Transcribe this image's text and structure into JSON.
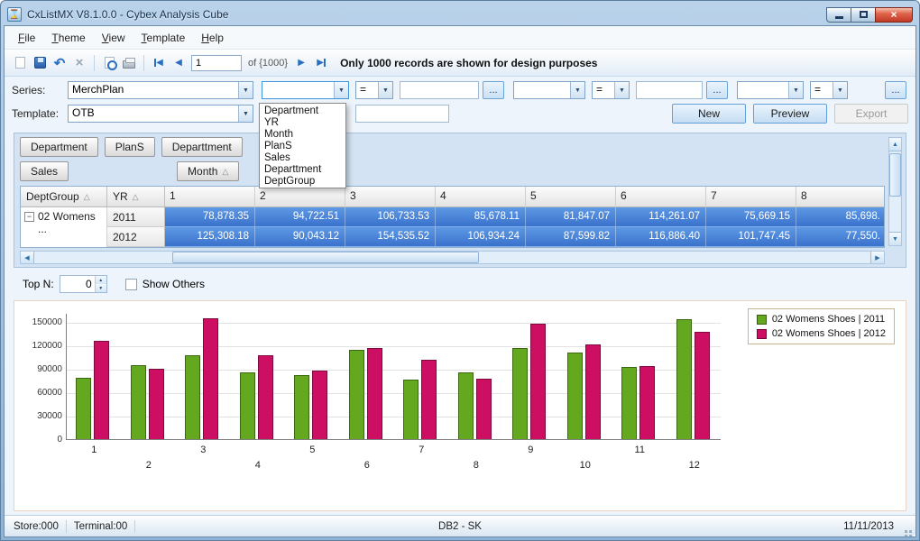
{
  "window": {
    "title": "CxListMX  V8.1.0.0 - Cybex Analysis Cube"
  },
  "icons": {
    "app": "⌛",
    "close": "×",
    "undo": "↶",
    "delete": "×",
    "combo_arrow": "▼",
    "sort_asc": "△",
    "collapse": "−",
    "nav_prev": "◀",
    "nav_next": "▶",
    "scroll_up": "▲",
    "scroll_down": "▼",
    "scroll_left": "◀",
    "scroll_right": "▶",
    "spin_up": "▲",
    "spin_down": "▼"
  },
  "menu": {
    "items": [
      "File",
      "Theme",
      "View",
      "Template",
      "Help"
    ]
  },
  "toolbar": {
    "page_value": "1",
    "of_label": "of {1000}",
    "message": "Only 1000 records are shown for design purposes"
  },
  "series": {
    "label": "Series:",
    "field_combo": "MerchPlan",
    "eq": "=",
    "ellipsis": "...",
    "dropdown_items": [
      "Department",
      "YR",
      "Month",
      "PlanS",
      "Sales",
      "Departtment",
      "DeptGroup"
    ]
  },
  "template": {
    "label": "Template:",
    "combo": "OTB",
    "new_label": "New",
    "preview_label": "Preview",
    "export_label": "Export"
  },
  "pivot": {
    "fields_row1": [
      "Department",
      "PlanS",
      "Departtment"
    ],
    "data_field": "Sales",
    "column_field": "Month",
    "row_field1": "DeptGroup",
    "row_field2": "YR",
    "columns": [
      "1",
      "2",
      "3",
      "4",
      "5",
      "6",
      "7",
      "8"
    ],
    "group_label": "02  Womens ...",
    "rows": [
      {
        "year": "2011",
        "values": [
          "78,878.35",
          "94,722.51",
          "106,733.53",
          "85,678.11",
          "81,847.07",
          "114,261.07",
          "75,669.15",
          "85,698."
        ]
      },
      {
        "year": "2012",
        "values": [
          "125,308.18",
          "90,043.12",
          "154,535.52",
          "106,934.24",
          "87,599.82",
          "116,886.40",
          "101,747.45",
          "77,550."
        ]
      }
    ]
  },
  "topn": {
    "label": "Top N:",
    "value": "0",
    "show_others": "Show Others"
  },
  "chart_data": {
    "type": "bar",
    "categories": [
      "1",
      "2",
      "3",
      "4",
      "5",
      "6",
      "7",
      "8",
      "9",
      "10",
      "11",
      "12"
    ],
    "series": [
      {
        "name": "02  Womens Shoes | 2011",
        "color": "#63a81e",
        "values": [
          78878,
          94723,
          106734,
          85678,
          81847,
          114261,
          75669,
          85698,
          116000,
          111000,
          92000,
          153000
        ]
      },
      {
        "name": "02  Womens Shoes | 2012",
        "color": "#cc0f63",
        "values": [
          125308,
          90043,
          154536,
          106934,
          87600,
          116886,
          101747,
          77550,
          148000,
          121000,
          94000,
          137000
        ]
      }
    ],
    "ylim": [
      0,
      160000
    ],
    "yticks": [
      0,
      30000,
      60000,
      90000,
      120000,
      150000
    ],
    "xlabel": "",
    "ylabel": "",
    "grid": true,
    "legend_position": "top-right"
  },
  "statusbar": {
    "store": "Store:000",
    "terminal": "Terminal:00",
    "db": "DB2 - SK",
    "date": "11/11/2013"
  }
}
